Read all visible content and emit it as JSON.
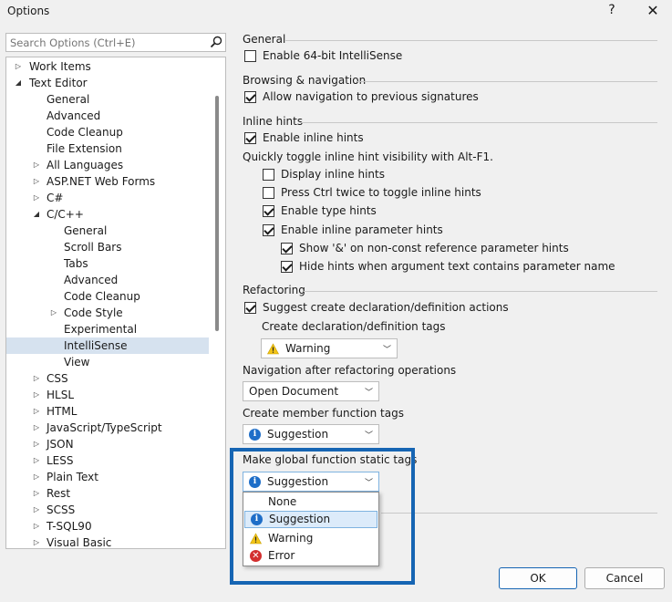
{
  "window": {
    "title": "Options",
    "help": "?",
    "close": "✕"
  },
  "search": {
    "placeholder": "Search Options (Ctrl+E)"
  },
  "tree": [
    {
      "label": "Work Items",
      "arrow": "▷"
    },
    {
      "label": "Text Editor",
      "arrow": "◢"
    },
    {
      "label": "General",
      "arrow": ""
    },
    {
      "label": "Advanced",
      "arrow": ""
    },
    {
      "label": "Code Cleanup",
      "arrow": ""
    },
    {
      "label": "File Extension",
      "arrow": ""
    },
    {
      "label": "All Languages",
      "arrow": "▷"
    },
    {
      "label": "ASP.NET Web Forms",
      "arrow": "▷"
    },
    {
      "label": "C#",
      "arrow": "▷"
    },
    {
      "label": "C/C++",
      "arrow": "◢"
    },
    {
      "label": "General",
      "arrow": ""
    },
    {
      "label": "Scroll Bars",
      "arrow": ""
    },
    {
      "label": "Tabs",
      "arrow": ""
    },
    {
      "label": "Advanced",
      "arrow": ""
    },
    {
      "label": "Code Cleanup",
      "arrow": ""
    },
    {
      "label": "Code Style",
      "arrow": "▷"
    },
    {
      "label": "Experimental",
      "arrow": ""
    },
    {
      "label": "IntelliSense",
      "arrow": "",
      "selected": true
    },
    {
      "label": "View",
      "arrow": ""
    },
    {
      "label": "CSS",
      "arrow": "▷"
    },
    {
      "label": "HLSL",
      "arrow": "▷"
    },
    {
      "label": "HTML",
      "arrow": "▷"
    },
    {
      "label": "JavaScript/TypeScript",
      "arrow": "▷"
    },
    {
      "label": "JSON",
      "arrow": "▷"
    },
    {
      "label": "LESS",
      "arrow": "▷"
    },
    {
      "label": "Plain Text",
      "arrow": "▷"
    },
    {
      "label": "Rest",
      "arrow": "▷"
    },
    {
      "label": "SCSS",
      "arrow": "▷"
    },
    {
      "label": "T-SQL90",
      "arrow": "▷"
    },
    {
      "label": "Visual Basic",
      "arrow": "▷"
    }
  ],
  "sections": {
    "general": {
      "header": "General",
      "enable64": "Enable 64-bit IntelliSense"
    },
    "browsing": {
      "header": "Browsing & navigation",
      "allow_nav": "Allow navigation to previous signatures"
    },
    "inline": {
      "header": "Inline hints",
      "enable_inline": "Enable inline hints",
      "toggle_note": "Quickly toggle inline hint visibility with Alt-F1.",
      "display_inline": "Display inline hints",
      "press_ctrl": "Press Ctrl twice to toggle inline hints",
      "enable_type": "Enable type hints",
      "enable_param": "Enable inline parameter hints",
      "show_amp": "Show '&' on non-const reference parameter hints",
      "hide_hints": "Hide hints when argument text contains parameter name"
    },
    "refactoring": {
      "header": "Refactoring",
      "suggest_decl": "Suggest create declaration/definition actions",
      "create_decl_tags": "Create declaration/definition tags",
      "decl_value": "Warning",
      "nav_after": "Navigation after refactoring operations",
      "nav_value": "Open Document",
      "member_tags": "Create member function tags",
      "member_value": "Suggestion",
      "global_tags": "Make global function static tags",
      "global_value": "Suggestion"
    }
  },
  "dropdown": [
    "None",
    "Suggestion",
    "Warning",
    "Error"
  ],
  "buttons": {
    "ok": "OK",
    "cancel": "Cancel"
  },
  "colors": {
    "accent": "#1665b3",
    "info": "#1e6ec8",
    "warning": "#f2c417",
    "error": "#d32f2f",
    "selection": "#d6e2ef"
  }
}
